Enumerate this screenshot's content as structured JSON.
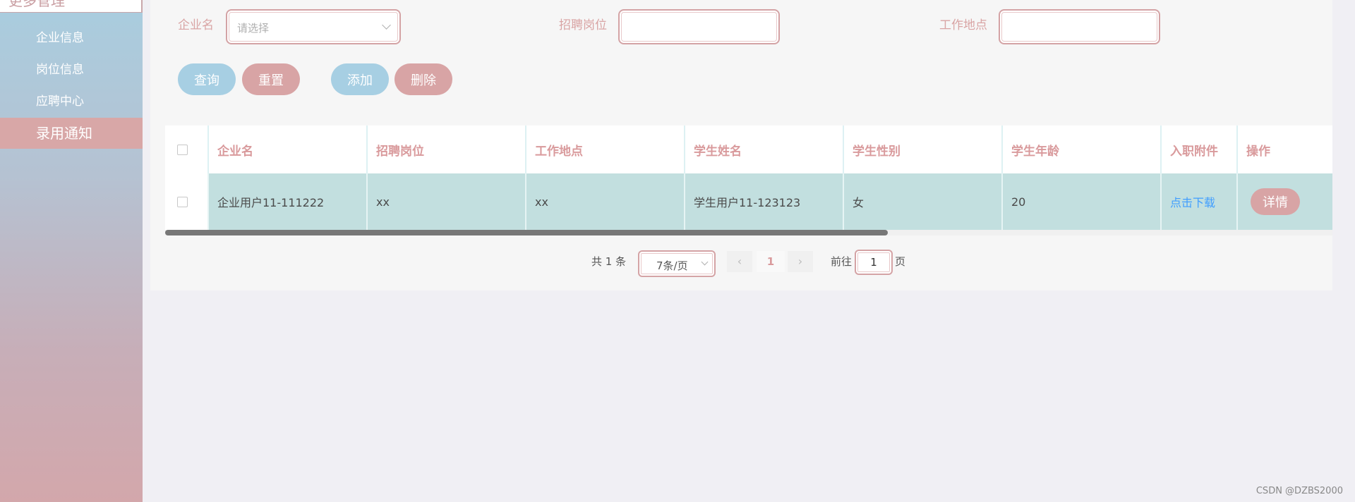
{
  "sidebar": {
    "header": "更多管理",
    "items": [
      {
        "label": "企业信息"
      },
      {
        "label": "岗位信息"
      },
      {
        "label": "应聘中心"
      },
      {
        "label": "录用通知"
      }
    ]
  },
  "filters": {
    "company_label": "企业名",
    "company_placeholder": "请选择",
    "position_label": "招聘岗位",
    "location_label": "工作地点"
  },
  "actions": {
    "query": "查询",
    "reset": "重置",
    "add": "添加",
    "delete": "删除"
  },
  "table": {
    "headers": [
      "企业名",
      "招聘岗位",
      "工作地点",
      "学生姓名",
      "学生性别",
      "学生年龄",
      "入职附件",
      "操作"
    ],
    "rows": [
      {
        "company": "企业用户11-111222",
        "position": "xx",
        "location": "xx",
        "student_name": "学生用户11-123123",
        "gender": "女",
        "age": "20",
        "attachment_link": "点击下载",
        "detail_button": "详情"
      }
    ]
  },
  "pagination": {
    "total": "共 1 条",
    "page_size": "7条/页",
    "prev": "‹",
    "current_page": "1",
    "next": "›",
    "goto_prefix": "前往",
    "goto_value": "1",
    "goto_suffix": "页"
  },
  "watermark": "CSDN @DZBS2000"
}
